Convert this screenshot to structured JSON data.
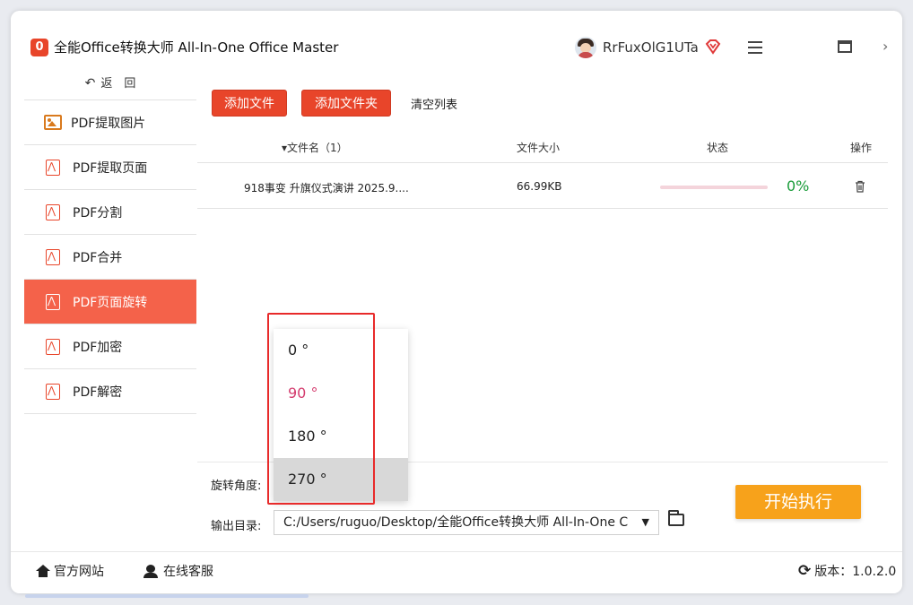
{
  "window": {
    "title": "全能Office转换大师 All-In-One Office Master",
    "logo_char": "0",
    "username": "RrFuxOlG1UTa"
  },
  "sidebar": {
    "back_label": "返　回",
    "items": [
      {
        "label": "PDF提取图片",
        "icon": "image-icon",
        "active": false
      },
      {
        "label": "PDF提取页面",
        "icon": "pdf-icon",
        "active": false
      },
      {
        "label": "PDF分割",
        "icon": "pdf-icon",
        "active": false
      },
      {
        "label": "PDF合并",
        "icon": "pdf-icon",
        "active": false
      },
      {
        "label": "PDF页面旋转",
        "icon": "pdf-icon",
        "active": true
      },
      {
        "label": "PDF加密",
        "icon": "pdf-icon",
        "active": false
      },
      {
        "label": "PDF解密",
        "icon": "pdf-icon",
        "active": false
      }
    ]
  },
  "toolbar": {
    "add_file": "添加文件",
    "add_folder": "添加文件夹",
    "clear_list": "清空列表"
  },
  "table": {
    "headers": {
      "name": "▾文件名（1）",
      "size": "文件大小",
      "status": "状态",
      "action": "操作"
    },
    "rows": [
      {
        "name": "918事变 升旗仪式演讲 2025.9....",
        "size": "66.99KB",
        "progress": 0.0,
        "progress_text": "0%"
      }
    ]
  },
  "settings": {
    "rotate_label": "旋转角度:",
    "output_label": "输出目录:",
    "output_path": "C:/Users/ruguo/Desktop/全能Office转换大师 All-In-One C",
    "start_button": "开始执行"
  },
  "dropdown": {
    "options": [
      "0 °",
      "90 °",
      "180 °",
      "270 °"
    ],
    "selected_index": 1,
    "hover_index": 3
  },
  "footer": {
    "website": "官方网站",
    "support": "在线客服",
    "version": "版本：1.0.2.0"
  },
  "colors": {
    "accent": "#e8452a",
    "active_sidebar": "#f4624a",
    "start_button": "#f7a21b",
    "selected_option": "#d43c6e",
    "progress_text": "#1a9c3a"
  }
}
